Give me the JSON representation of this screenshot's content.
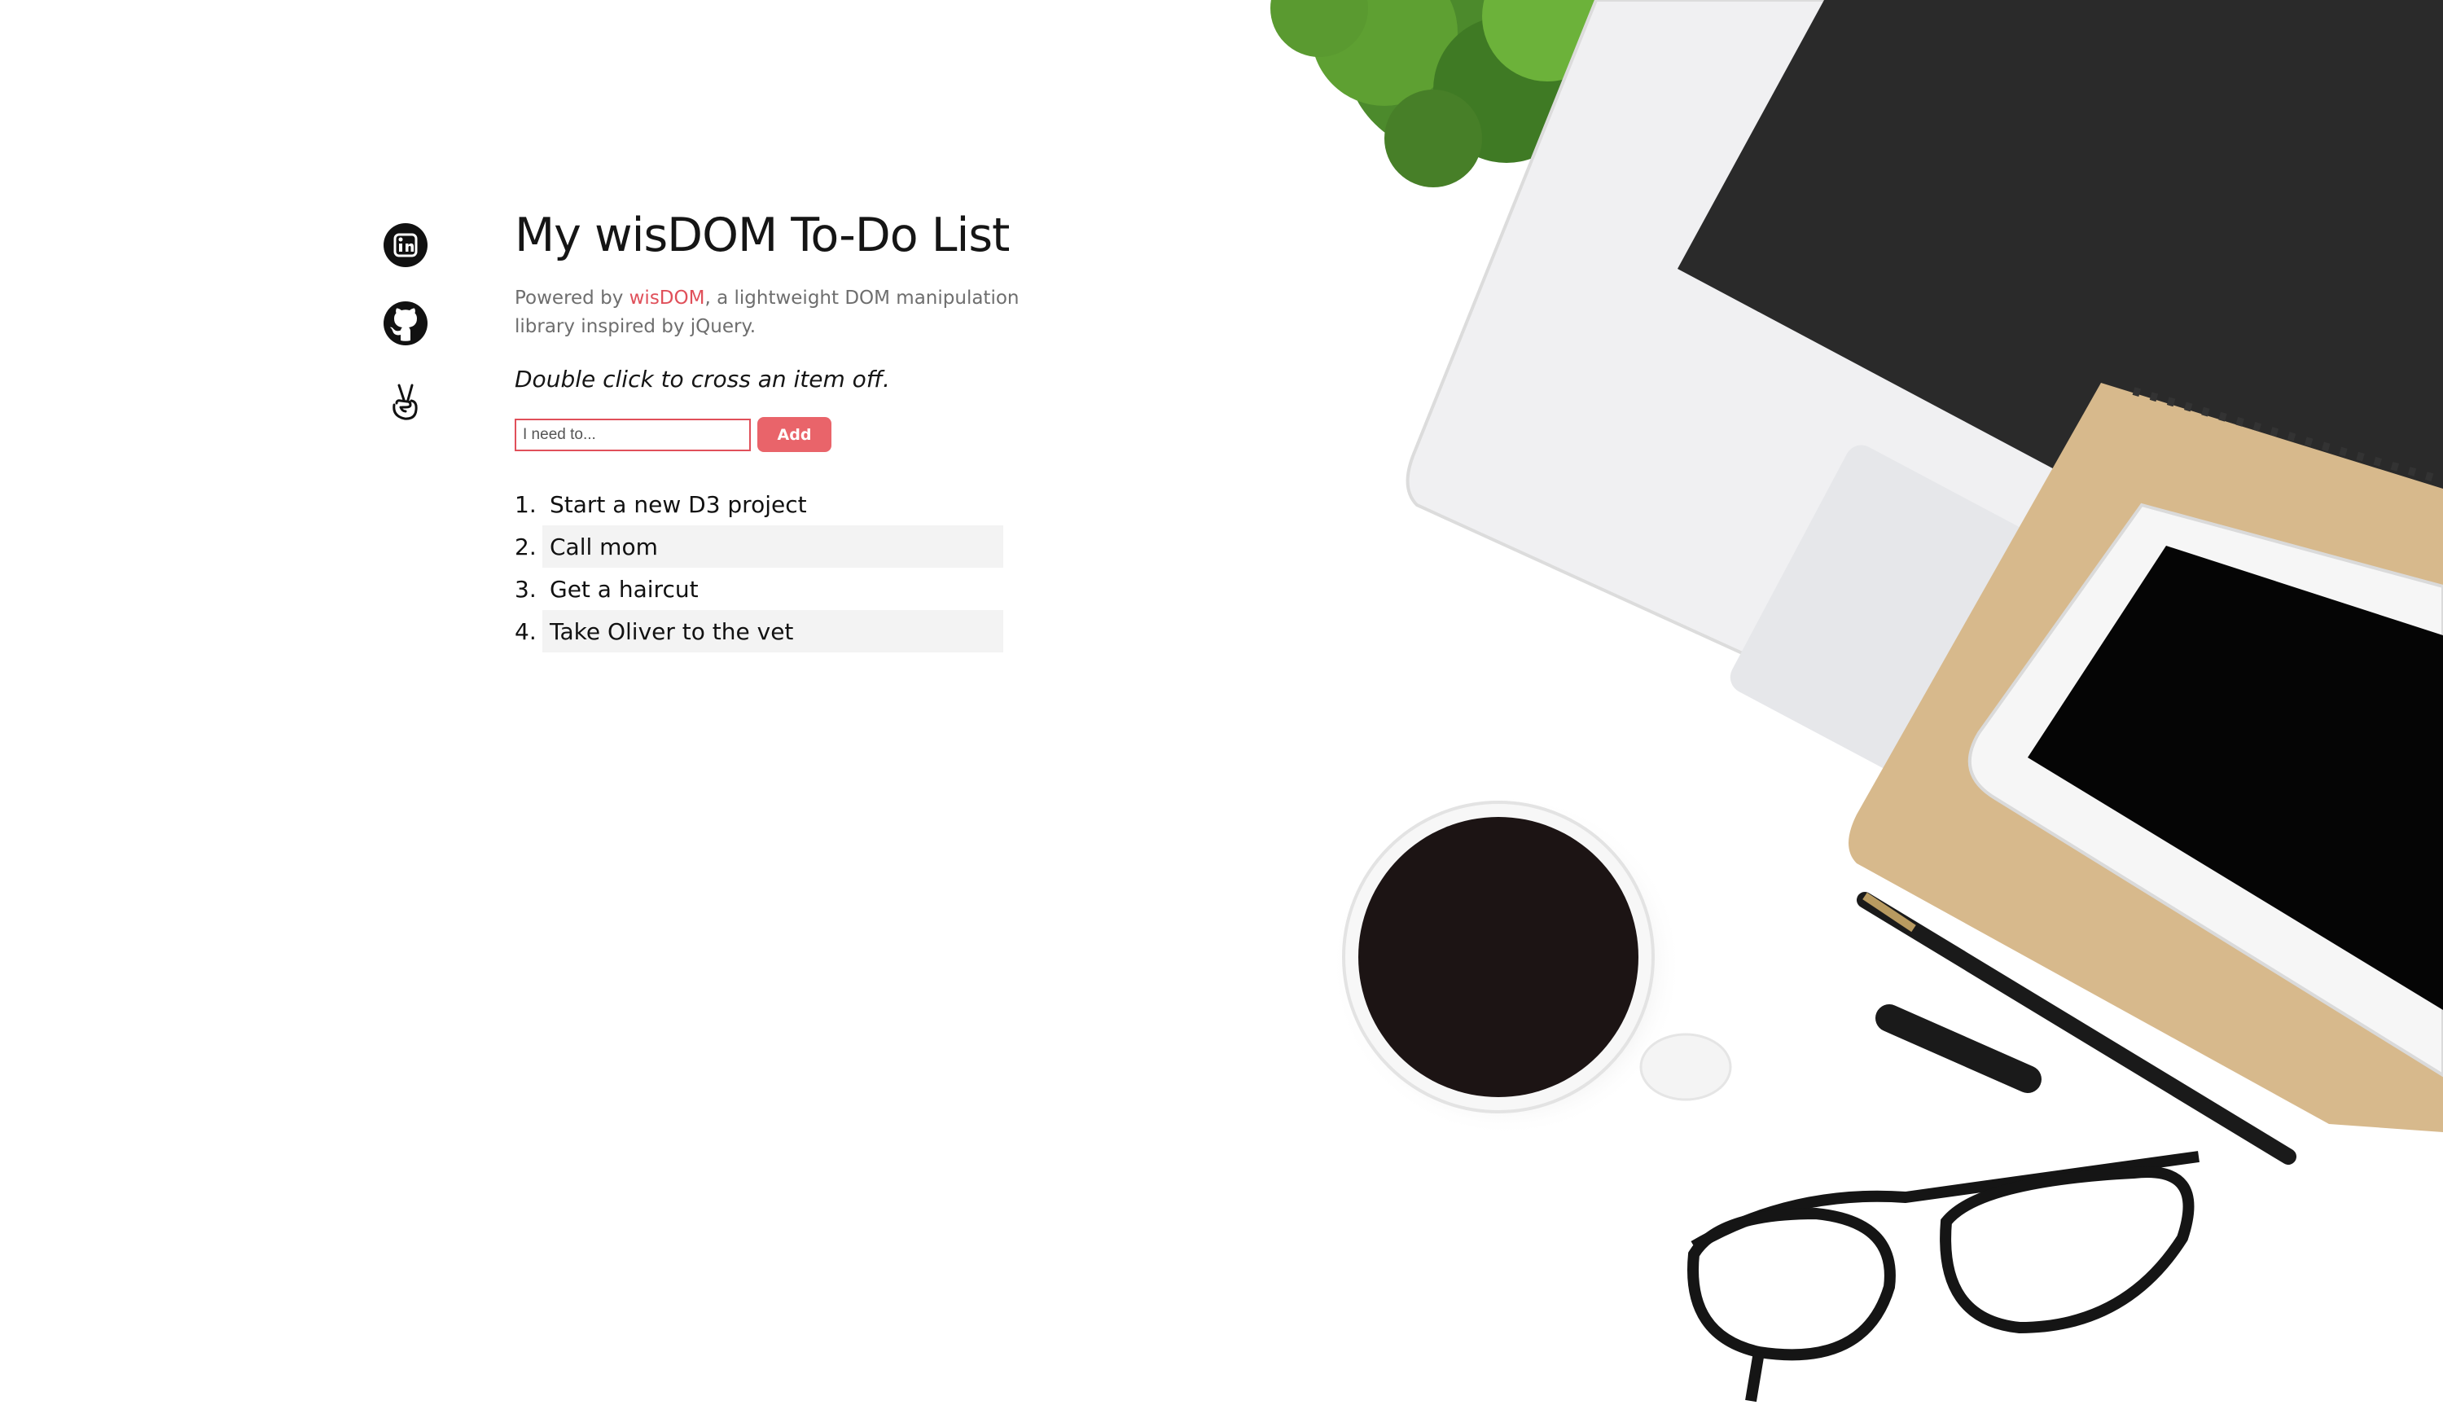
{
  "app": {
    "title": "My wisDOM To-Do List",
    "powered_prefix": "Powered by ",
    "library_name": "wisDOM",
    "powered_suffix": ", a lightweight DOM manipulation library inspired by jQuery.",
    "hint": "Double click to cross an item off."
  },
  "form": {
    "input_placeholder": "I need to...",
    "input_value": "",
    "add_label": "Add"
  },
  "todos": [
    {
      "number": "1.",
      "text": "Start a new D3 project"
    },
    {
      "number": "2.",
      "text": "Call mom"
    },
    {
      "number": "3.",
      "text": "Get a haircut"
    },
    {
      "number": "4.",
      "text": "Take Oliver to the vet"
    }
  ],
  "social": [
    {
      "icon": "linkedin-icon"
    },
    {
      "icon": "github-icon"
    },
    {
      "icon": "angellist-icon"
    }
  ],
  "colors": {
    "accent": "#e0505a",
    "button": "#e9646a",
    "alt_row": "#f3f3f3"
  }
}
